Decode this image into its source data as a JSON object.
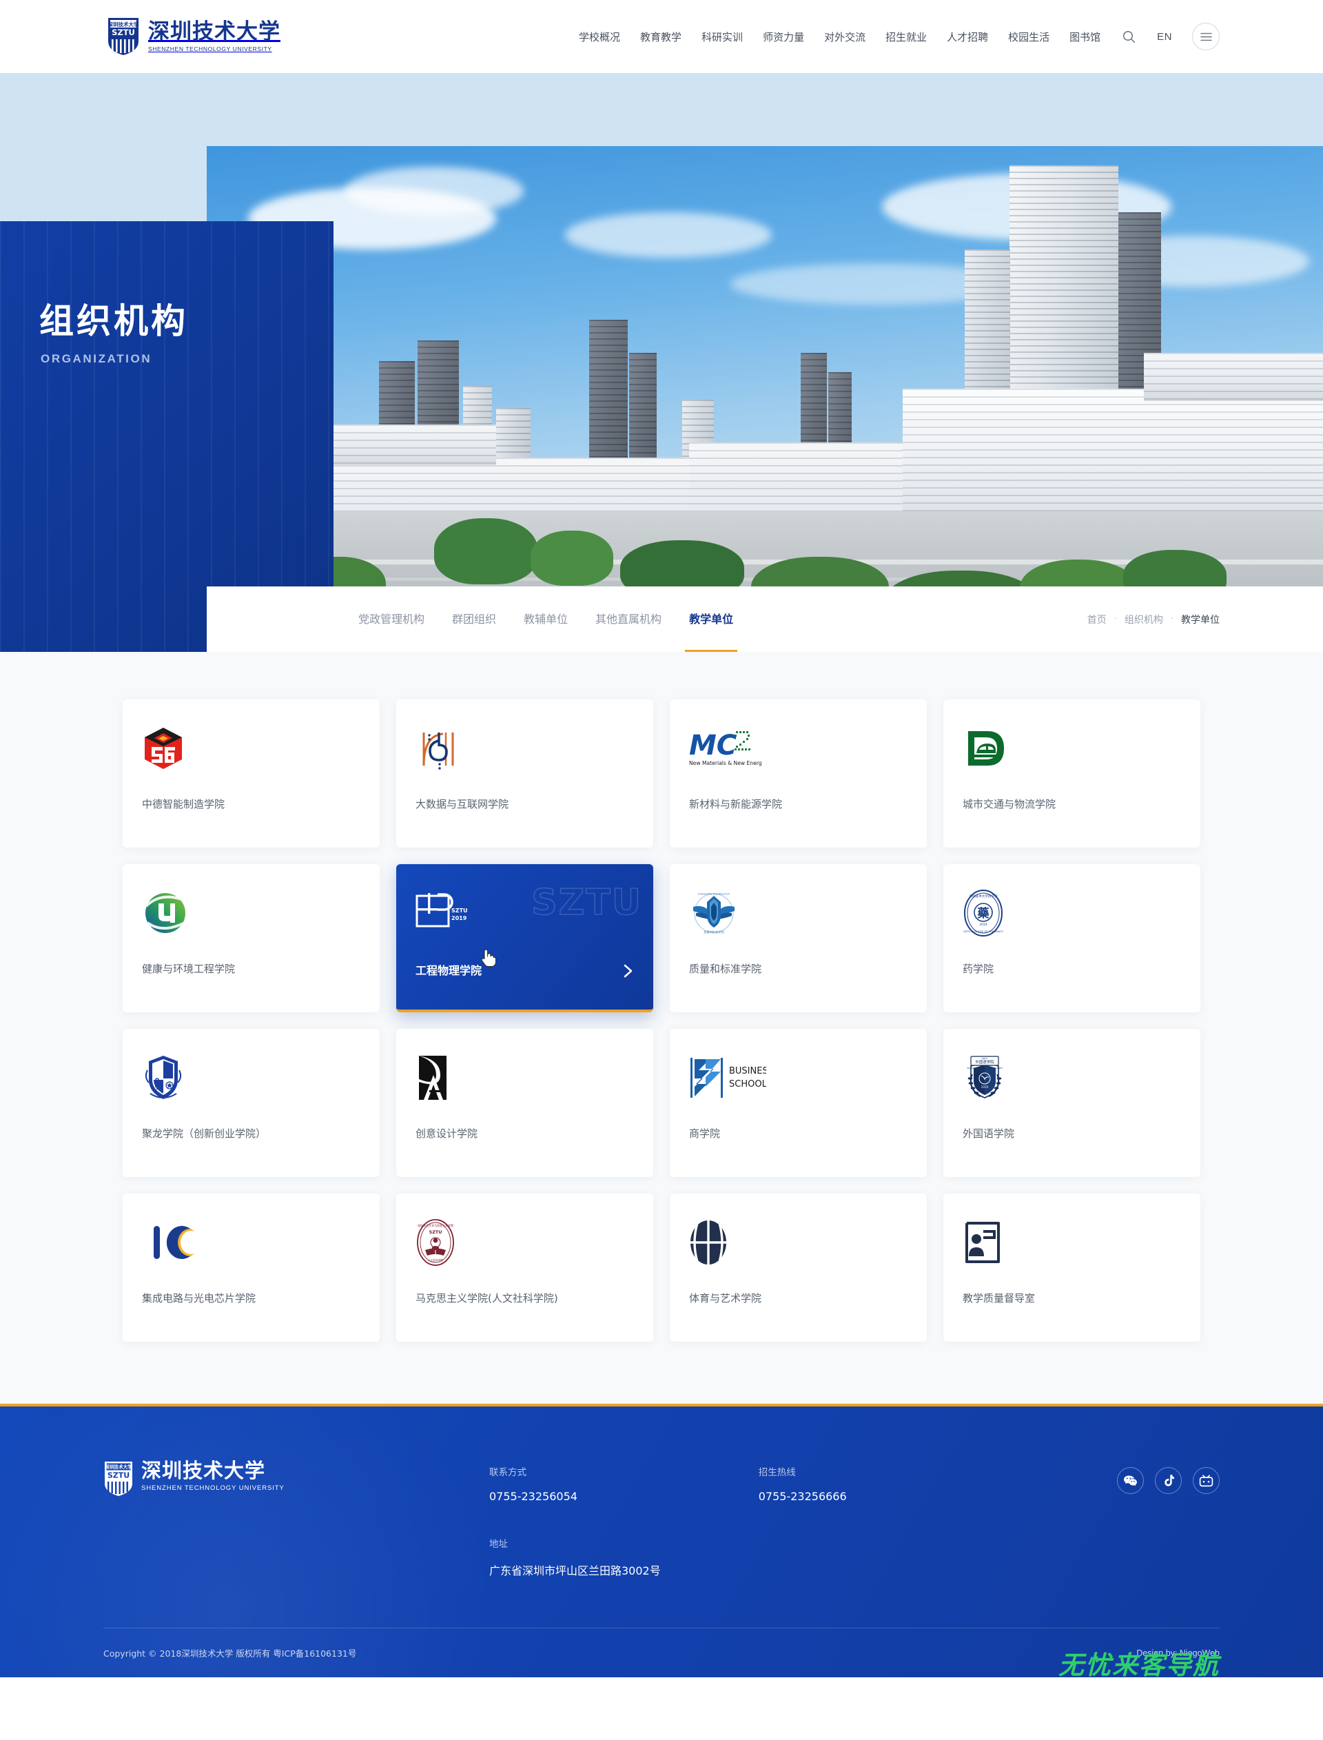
{
  "header": {
    "logo": {
      "cn": "深圳技术大学",
      "en": "SHENZHEN TECHNOLOGY UNIVERSITY",
      "crest_cn": "深圳技术大学",
      "crest_abbr": "SZTU"
    },
    "nav": [
      {
        "label": "学校概况"
      },
      {
        "label": "教育教学"
      },
      {
        "label": "科研实训"
      },
      {
        "label": "师资力量"
      },
      {
        "label": "对外交流"
      },
      {
        "label": "招生就业"
      },
      {
        "label": "人才招聘"
      },
      {
        "label": "校园生活"
      },
      {
        "label": "图书馆"
      }
    ],
    "search_icon": "search-icon",
    "lang_label": "EN",
    "menu_icon": "hamburger-icon"
  },
  "hero": {
    "title": "组织机构",
    "subtitle": "ORGANIZATION",
    "scroll_icon": "scroll-down-arrow"
  },
  "tabs": [
    {
      "label": "党政管理机构",
      "active": false
    },
    {
      "label": "群团组织",
      "active": false
    },
    {
      "label": "教辅单位",
      "active": false
    },
    {
      "label": "其他直属机构",
      "active": false
    },
    {
      "label": "教学单位",
      "active": true
    }
  ],
  "breadcrumb": {
    "items": [
      "首页",
      "组织机构",
      "教学单位"
    ],
    "separator": "·"
  },
  "colors": {
    "brand_blue": "#15368f",
    "accent_orange": "#f0a21e",
    "card_active_blue": "#1240ab",
    "page_bg": "#f7f9fb",
    "watermark_green": "#2fd06a"
  },
  "cards": [
    {
      "name": "中德智能制造学院",
      "logo": "sg-hexagon-logo",
      "active": false
    },
    {
      "name": "大数据与互联网学院",
      "logo": "big-data-b-logo",
      "active": false
    },
    {
      "name": "新材料与新能源学院",
      "logo": "mc2-logo",
      "logo_text": "MC",
      "logo_sup": "2",
      "logo_caption": "New Materials & New Energy",
      "active": false
    },
    {
      "name": "城市交通与物流学院",
      "logo": "green-d-transport-logo",
      "active": false
    },
    {
      "name": "健康与环境工程学院",
      "logo": "health-environment-circle-logo",
      "active": false
    },
    {
      "name": "工程物理学院",
      "logo": "ep-sztu-2019-logo",
      "logo_text": "EP",
      "logo_sub1": "SZTU",
      "logo_sub2": "2019",
      "watermark": "SZTU",
      "arrow": "chevron-right-icon",
      "active": true
    },
    {
      "name": "质量和标准学院",
      "logo": "quality-standard-wing-shield-logo",
      "active": false
    },
    {
      "name": "药学院",
      "logo": "pharmacy-oval-seal-logo",
      "active": false
    },
    {
      "name": "聚龙学院（创新创业学院）",
      "logo": "julong-crest-logo",
      "active": false
    },
    {
      "name": "创意设计学院",
      "logo": "creative-design-black-mark-logo",
      "active": false
    },
    {
      "name": "商学院",
      "logo": "business-school-logo",
      "logo_line1": "BUSINESS",
      "logo_line2": "SCHOOL",
      "active": false
    },
    {
      "name": "外国语学院",
      "logo": "foreign-languages-laurel-crest-logo",
      "active": false
    },
    {
      "name": "集成电路与光电芯片学院",
      "logo": "ic-logo",
      "active": false
    },
    {
      "name": "马克思主义学院(人文社科学院)",
      "logo": "marxism-oval-seal-logo",
      "active": false
    },
    {
      "name": "体育与艺术学院",
      "logo": "basketball-logo",
      "active": false
    },
    {
      "name": "教学质量督导室",
      "logo": "teaching-quality-document-icon",
      "active": false
    }
  ],
  "footer": {
    "logo": {
      "cn": "深圳技术大学",
      "en": "SHENZHEN TECHNOLOGY UNIVERSITY"
    },
    "contact_label": "联系方式",
    "contact_value": "0755-23256054",
    "admission_label": "招生热线",
    "admission_value": "0755-23256666",
    "address_label": "地址",
    "address_value": "广东省深圳市坪山区兰田路3002号",
    "social": [
      {
        "name": "wechat-icon"
      },
      {
        "name": "douyin-icon"
      },
      {
        "name": "bilibili-icon"
      }
    ],
    "copyright": "Copyright © 2018深圳技术大学 版权所有 粤ICP备16106131号",
    "design_by": "Design by: NiegoWeb"
  },
  "watermark": "无忧来客导航"
}
